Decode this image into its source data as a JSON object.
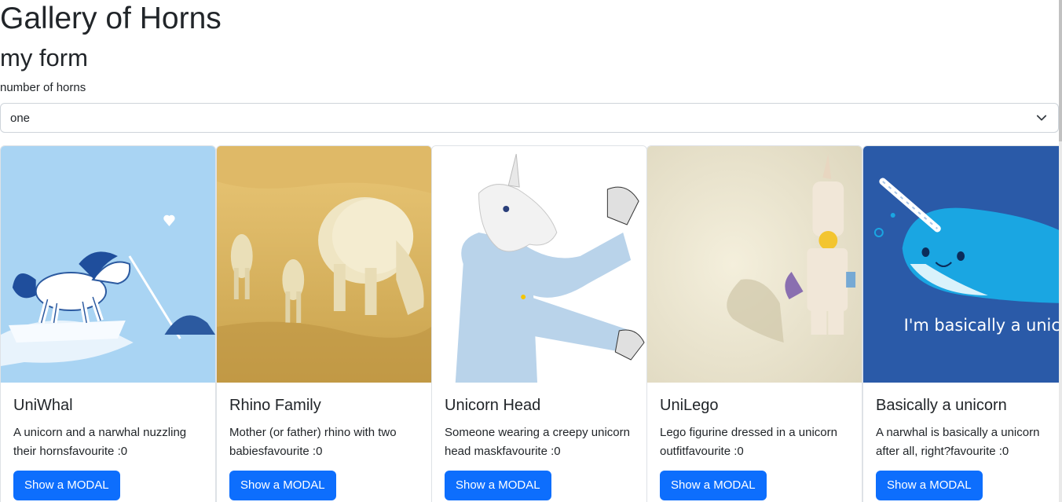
{
  "header": {
    "title": "Gallery of Horns"
  },
  "form": {
    "title": "my form",
    "label": "number of horns",
    "select_value": "one"
  },
  "cards": [
    {
      "title": "UniWhal",
      "description": "A unicorn and a narwhal nuzzling their hornsfavourite :0",
      "button": "Show a MODAL"
    },
    {
      "title": "Rhino Family",
      "description": "Mother (or father) rhino with two babiesfavourite :0",
      "button": "Show a MODAL"
    },
    {
      "title": "Unicorn Head",
      "description": "Someone wearing a creepy unicorn head maskfavourite :0",
      "button": "Show a MODAL"
    },
    {
      "title": "UniLego",
      "description": "Lego figurine dressed in a unicorn outfitfavourite :0",
      "button": "Show a MODAL"
    },
    {
      "title": "Basically a unicorn",
      "description": "A narwhal is basically a unicorn after all, right?favourite :0",
      "button": "Show a MODAL",
      "image_caption": "I'm basically a unicorn"
    }
  ],
  "colors": {
    "primary": "#0d6efd",
    "text": "#212529",
    "border": "#dee2e6"
  },
  "icons": {
    "select_arrow": "chevron-down-icon"
  }
}
